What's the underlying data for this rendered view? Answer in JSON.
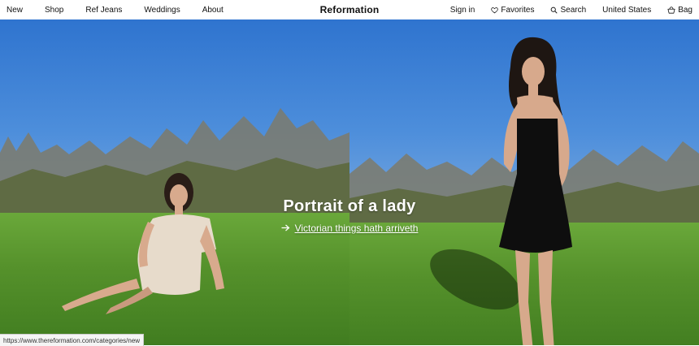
{
  "header": {
    "brand": "Reformation",
    "left_nav": [
      {
        "label": "New"
      },
      {
        "label": "Shop"
      },
      {
        "label": "Ref Jeans"
      },
      {
        "label": "Weddings"
      },
      {
        "label": "About"
      }
    ],
    "right_nav": {
      "sign_in": "Sign in",
      "favorites": "Favorites",
      "search": "Search",
      "region": "United States",
      "bag": "Bag"
    }
  },
  "hero": {
    "title": "Portrait of a lady",
    "link_text": "Victorian things hath arriveth"
  },
  "status_bar": {
    "url": "https://www.thereformation.com/categories/new"
  }
}
